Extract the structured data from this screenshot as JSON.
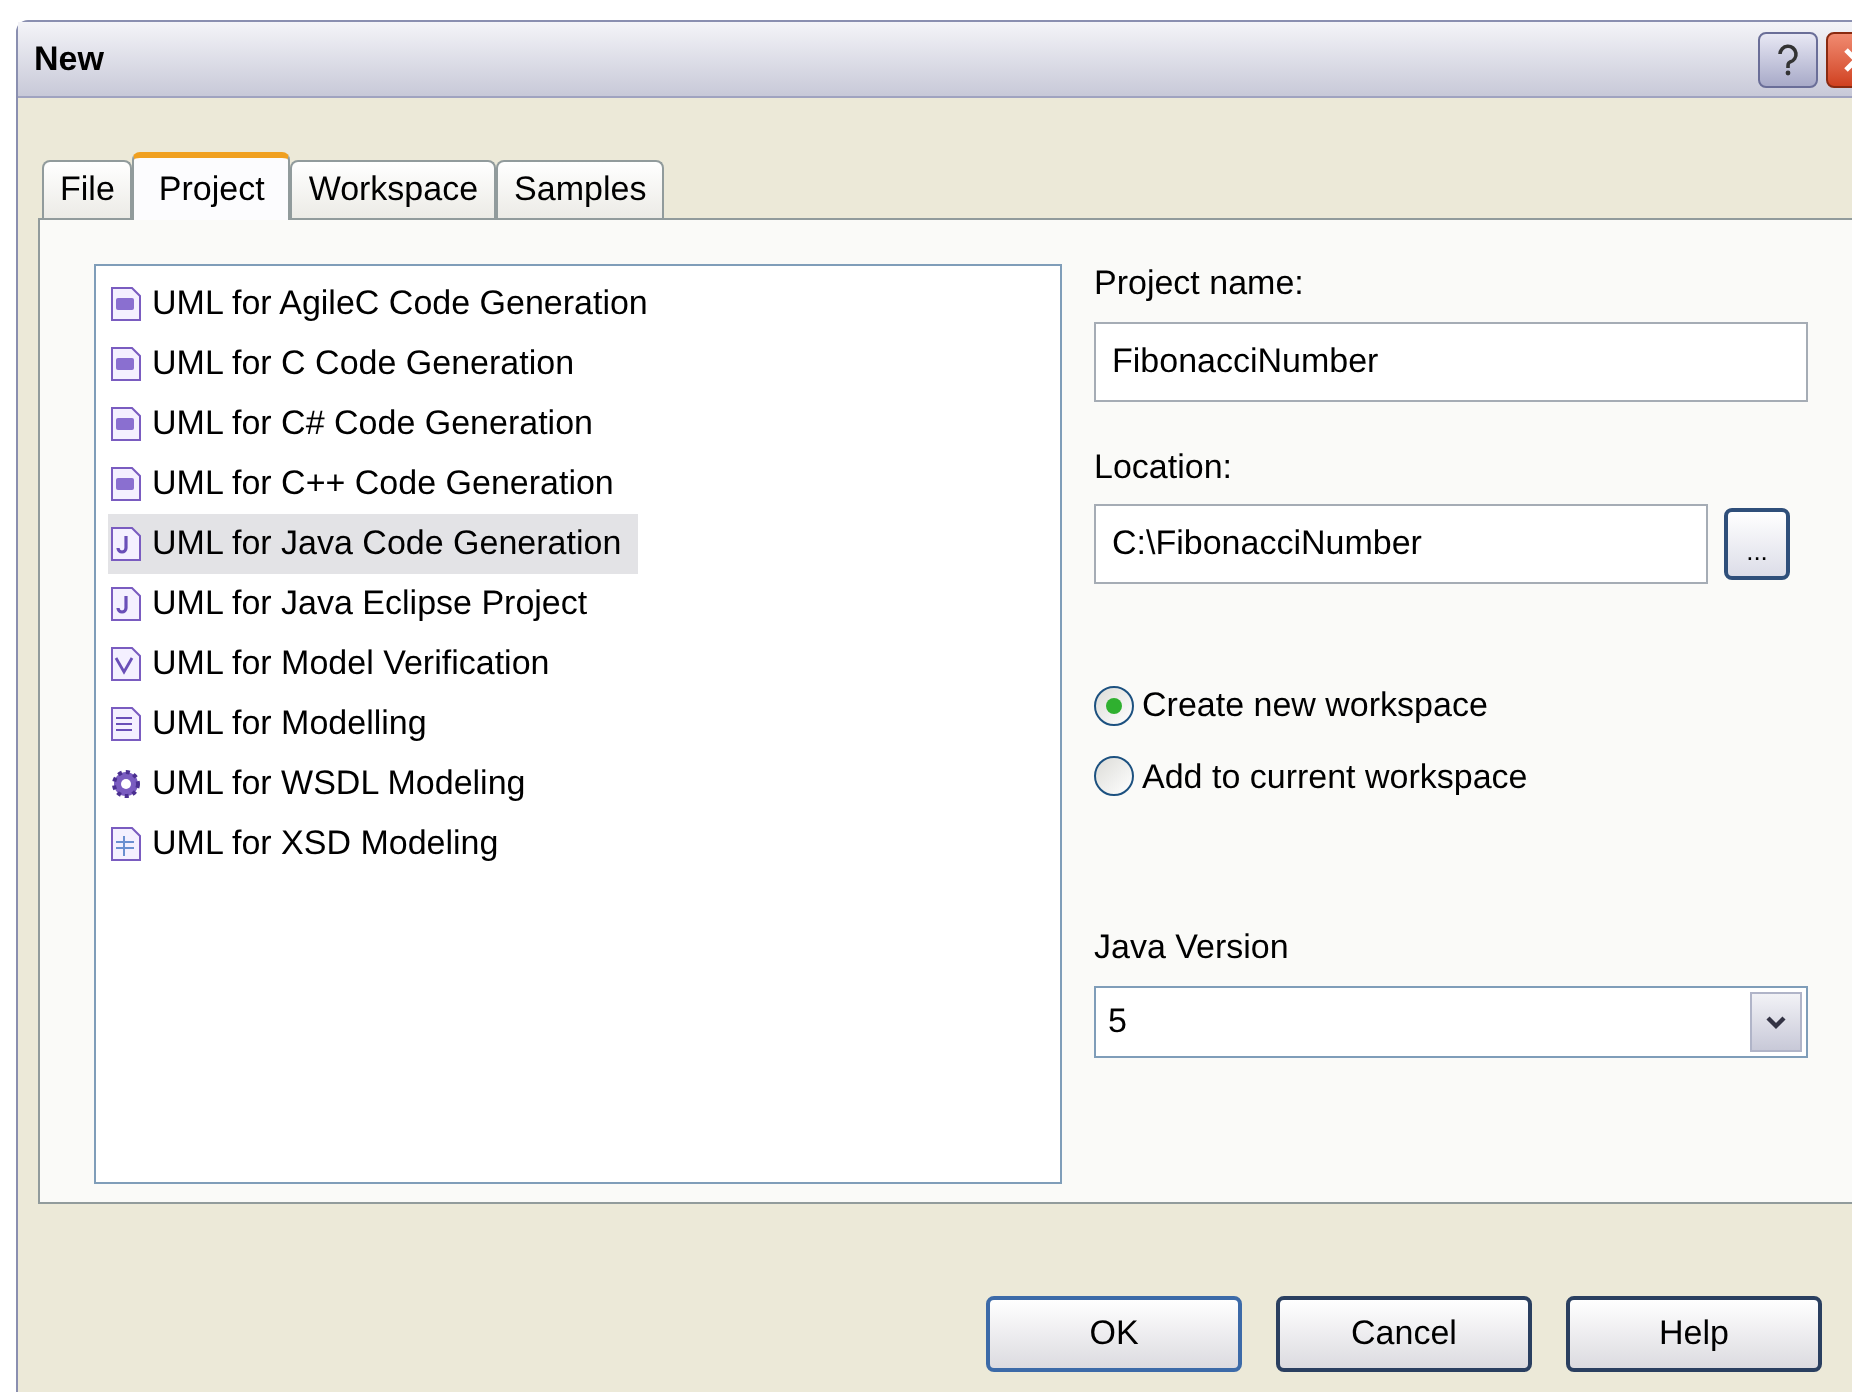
{
  "window": {
    "title": "New"
  },
  "tabs": [
    {
      "label": "File",
      "selected": false
    },
    {
      "label": "Project",
      "selected": true
    },
    {
      "label": "Workspace",
      "selected": false
    },
    {
      "label": "Samples",
      "selected": false
    }
  ],
  "project_types": [
    {
      "label": "UML for AgileC Code Generation",
      "kind": "code",
      "selected": false
    },
    {
      "label": "UML for C Code Generation",
      "kind": "code",
      "selected": false
    },
    {
      "label": "UML for C# Code Generation",
      "kind": "code",
      "selected": false
    },
    {
      "label": "UML for C++ Code Generation",
      "kind": "code",
      "selected": false
    },
    {
      "label": "UML for Java Code Generation",
      "kind": "java",
      "selected": true
    },
    {
      "label": "UML for Java Eclipse Project",
      "kind": "java",
      "selected": false
    },
    {
      "label": "UML for Model Verification",
      "kind": "verify",
      "selected": false
    },
    {
      "label": "UML for Modelling",
      "kind": "doc",
      "selected": false
    },
    {
      "label": "UML for WSDL Modeling",
      "kind": "gear",
      "selected": false
    },
    {
      "label": "UML for XSD Modeling",
      "kind": "table",
      "selected": false
    }
  ],
  "project_name": {
    "label": "Project name:",
    "value": "FibonacciNumber"
  },
  "location": {
    "label": "Location:",
    "value": "C:\\FibonacciNumber",
    "browse": "..."
  },
  "workspace_options": [
    {
      "label": "Create new workspace",
      "selected": true
    },
    {
      "label": "Add to current workspace",
      "selected": false
    }
  ],
  "java_version": {
    "label": "Java Version",
    "value": "5"
  },
  "buttons": [
    "OK",
    "Cancel",
    "Help"
  ]
}
